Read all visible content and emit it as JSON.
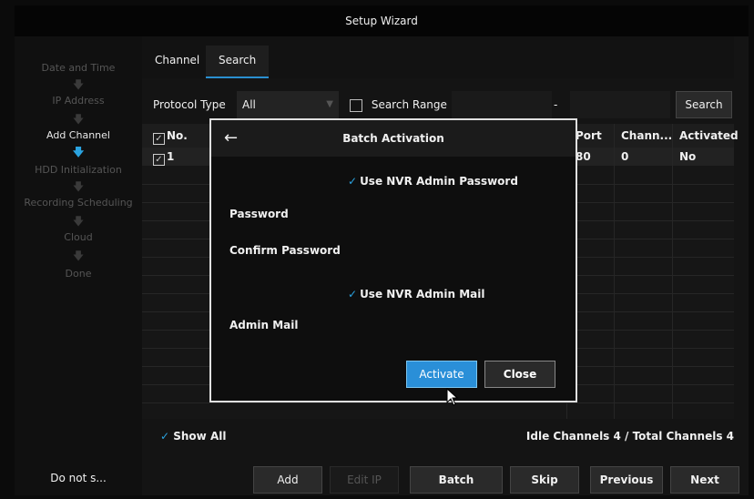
{
  "window": {
    "title": "Setup Wizard"
  },
  "sidebar": {
    "steps": [
      {
        "label": "Date and Time"
      },
      {
        "label": "IP Address"
      },
      {
        "label": "Add Channel"
      },
      {
        "label": "HDD Initialization"
      },
      {
        "label": "Recording Scheduling"
      },
      {
        "label": "Cloud"
      },
      {
        "label": "Done"
      }
    ],
    "down_arrow": "🡇",
    "do_not_show": "Do not s..."
  },
  "tabs": [
    {
      "label": "Channel"
    },
    {
      "label": "Search"
    }
  ],
  "filter": {
    "protocol_label": "Protocol Type",
    "protocol_value": "All",
    "search_range_label": "Search Range",
    "range_dash": "-",
    "search_button": "Search"
  },
  "table": {
    "columns": [
      "No.",
      "Port",
      "Chann...",
      "Activated"
    ],
    "rows": [
      {
        "no": "1",
        "port": "80",
        "channel": "0",
        "activated": "No"
      }
    ]
  },
  "footer": {
    "show_all": "Show All",
    "counts": "Idle Channels 4 / Total Channels 4"
  },
  "buttons": {
    "add": "Add",
    "edit_ip": "Edit IP",
    "batch_activation": "Batch Activation",
    "skip": "Skip",
    "previous": "Previous",
    "next": "Next"
  },
  "modal": {
    "title": "Batch Activation",
    "use_admin_password": "Use NVR Admin Password",
    "password_label": "Password",
    "confirm_password_label": "Confirm Password",
    "use_admin_mail": "Use NVR Admin Mail",
    "admin_mail_label": "Admin Mail",
    "activate_button": "Activate",
    "close_button": "Close"
  },
  "colors": {
    "accent": "#2a8fd8",
    "highlight": "#2aa3e0"
  },
  "icons": {
    "back": "arrow-left-icon",
    "check": "checkmark-icon",
    "cursor": "mouse-pointer-icon"
  }
}
